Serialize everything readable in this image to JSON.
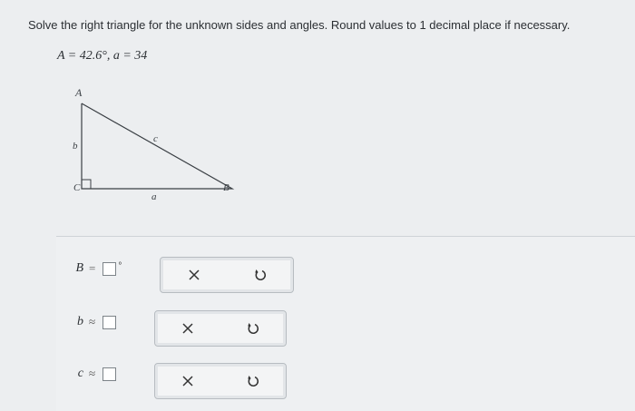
{
  "question": {
    "text": "Solve the right triangle for the unknown sides and angles. Round values to 1 decimal place if necessary.",
    "given": "A = 42.6°, a = 34"
  },
  "diagram": {
    "vertex_a": "A",
    "vertex_b": "B",
    "vertex_c": "C",
    "side_a": "a",
    "side_b": "b",
    "side_c": "c"
  },
  "answers": [
    {
      "label": "B",
      "relation": "=",
      "value": "",
      "unit": "°"
    },
    {
      "label": "b",
      "relation": "≈",
      "value": "",
      "unit": ""
    },
    {
      "label": "c",
      "relation": "≈",
      "value": "",
      "unit": ""
    }
  ],
  "icons": {
    "clear": "close-icon",
    "reset": "undo-icon"
  }
}
